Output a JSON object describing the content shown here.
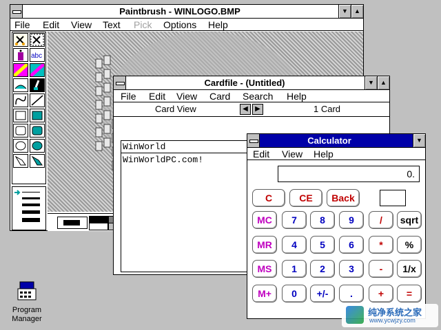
{
  "paintbrush": {
    "title": "Paintbrush - WINLOGO.BMP",
    "menu": [
      "File",
      "Edit",
      "View",
      "Text",
      "Pick",
      "Options",
      "Help"
    ],
    "menu_disabled": [
      "Pick"
    ]
  },
  "cardfile": {
    "title": "Cardfile - (Untitled)",
    "menu": [
      "File",
      "Edit",
      "View",
      "Card",
      "Search",
      "Help"
    ],
    "view_label": "Card View",
    "count_label": "1 Card",
    "card_title": "WinWorld",
    "card_body": "WinWorldPC.com!"
  },
  "calculator": {
    "title": "Calculator",
    "menu": [
      "Edit",
      "View",
      "Help"
    ],
    "display": "0.",
    "buttons": {
      "c": "C",
      "ce": "CE",
      "back": "Back",
      "mc": "MC",
      "mr": "MR",
      "ms": "MS",
      "mplus": "M+",
      "n7": "7",
      "n8": "8",
      "n9": "9",
      "div": "/",
      "sqrt": "sqrt",
      "n4": "4",
      "n5": "5",
      "n6": "6",
      "mul": "*",
      "pct": "%",
      "n1": "1",
      "n2": "2",
      "n3": "3",
      "sub": "-",
      "inv": "1/x",
      "n0": "0",
      "sign": "+/-",
      "dot": ".",
      "add": "+",
      "eq": "="
    }
  },
  "desktop": {
    "program_manager_line1": "Program",
    "program_manager_line2": "Manager"
  },
  "watermark": {
    "title": "纯净系统之家",
    "url": "www.ycwjzy.com"
  },
  "colors": {
    "desktop": "#c0c0c0",
    "active_title": "#0000a8",
    "calc_red": "#c00000",
    "calc_magenta": "#c000c0",
    "calc_blue": "#0000c0"
  }
}
